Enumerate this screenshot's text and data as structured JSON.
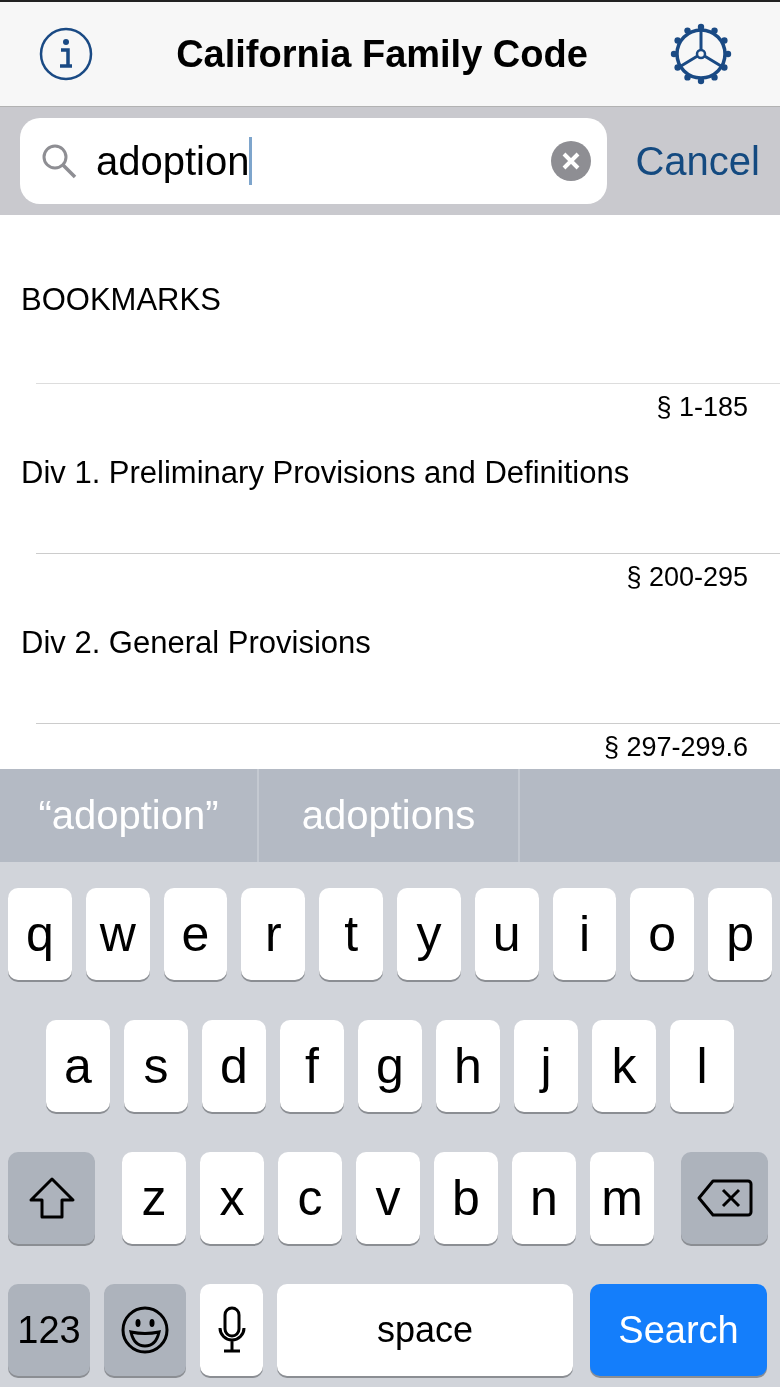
{
  "header": {
    "title": "California Family Code"
  },
  "search": {
    "value": "adoption",
    "cancel": "Cancel"
  },
  "list": {
    "section_header": "BOOKMARKS",
    "rows": [
      {
        "sections": "§ 1-185",
        "title": "Div 1. Preliminary Provisions and Definitions"
      },
      {
        "sections": "§ 200-295",
        "title": "Div 2. General Provisions"
      },
      {
        "sections": "§ 297-299.6"
      }
    ]
  },
  "suggestions": [
    "“adoption”",
    "adoptions"
  ],
  "keyboard": {
    "rows": [
      {
        "keys": [
          {
            "kind": "letter",
            "label": "q"
          },
          {
            "kind": "letter",
            "label": "w"
          },
          {
            "kind": "letter",
            "label": "e"
          },
          {
            "kind": "letter",
            "label": "r"
          },
          {
            "kind": "letter",
            "label": "t"
          },
          {
            "kind": "letter",
            "label": "y"
          },
          {
            "kind": "letter",
            "label": "u"
          },
          {
            "kind": "letter",
            "label": "i"
          },
          {
            "kind": "letter",
            "label": "o"
          },
          {
            "kind": "letter",
            "label": "p"
          }
        ]
      },
      {
        "keys": [
          {
            "kind": "letter",
            "label": "a"
          },
          {
            "kind": "letter",
            "label": "s"
          },
          {
            "kind": "letter",
            "label": "d"
          },
          {
            "kind": "letter",
            "label": "f"
          },
          {
            "kind": "letter",
            "label": "g"
          },
          {
            "kind": "letter",
            "label": "h"
          },
          {
            "kind": "letter",
            "label": "j"
          },
          {
            "kind": "letter",
            "label": "k"
          },
          {
            "kind": "letter",
            "label": "l"
          }
        ]
      },
      {
        "keys": [
          {
            "kind": "shift"
          },
          {
            "kind": "letter",
            "label": "z"
          },
          {
            "kind": "letter",
            "label": "x"
          },
          {
            "kind": "letter",
            "label": "c"
          },
          {
            "kind": "letter",
            "label": "v"
          },
          {
            "kind": "letter",
            "label": "b"
          },
          {
            "kind": "letter",
            "label": "n"
          },
          {
            "kind": "letter",
            "label": "m"
          },
          {
            "kind": "backspace"
          }
        ]
      },
      {
        "keys": [
          {
            "kind": "numbers",
            "label": "123"
          },
          {
            "kind": "emoji"
          },
          {
            "kind": "mic"
          },
          {
            "kind": "space",
            "label": "space"
          },
          {
            "kind": "search",
            "label": "Search"
          }
        ]
      }
    ]
  }
}
